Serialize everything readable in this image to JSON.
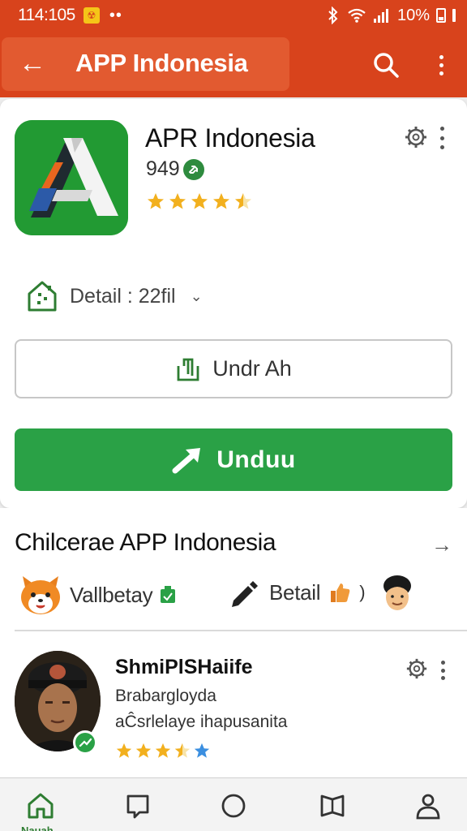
{
  "status_bar": {
    "time": "114:105",
    "notif_glyph": "☢",
    "dots": "••",
    "battery_percent": "10%"
  },
  "app_bar": {
    "title": "APP Indonesia",
    "back_glyph": "←"
  },
  "app_card": {
    "name": "APR Indonesia",
    "count": "949",
    "rating_stars": 4.5,
    "detail_label": "Detail : 22fil",
    "detail_chevron": "⌄",
    "secondary_button": "Undr Ah",
    "primary_button": "Unduu",
    "brand_color": "#229a33",
    "accent_color": "#d8431c"
  },
  "section": {
    "title": "Chilcerae APP Indonesia",
    "arrow": "→",
    "chip1_label": "Vallbetay",
    "chip2_label": "Betail",
    "chip2_paren": ")"
  },
  "review": {
    "name": "ShmiPlSHaiife",
    "subtitle": "Brabargloyda",
    "text": "aĈsrlelaye ihapusanita",
    "rating_stars": 3.5
  },
  "bottom_nav": {
    "active_label": "Nauah",
    "items": [
      "home-icon",
      "square-icon",
      "circle-icon",
      "bookmark-icon",
      "profile-icon"
    ]
  }
}
